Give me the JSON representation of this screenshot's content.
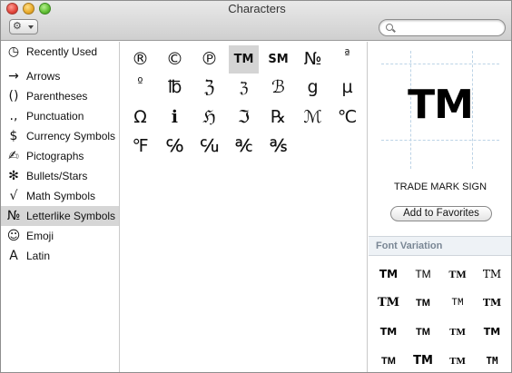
{
  "window": {
    "title": "Characters"
  },
  "toolbar": {
    "gear_icon": "gear-icon",
    "search_placeholder": "",
    "search_value": ""
  },
  "sidebar": {
    "items": [
      {
        "icon": "◷",
        "label": "Recently Used",
        "selected": false
      },
      {
        "icon": "→",
        "label": "Arrows",
        "selected": false
      },
      {
        "icon": "()",
        "label": "Parentheses",
        "selected": false
      },
      {
        "icon": ".,",
        "label": "Punctuation",
        "selected": false
      },
      {
        "icon": "$",
        "label": "Currency Symbols",
        "selected": false
      },
      {
        "icon": "✍",
        "label": "Pictographs",
        "selected": false
      },
      {
        "icon": "✻",
        "label": "Bullets/Stars",
        "selected": false
      },
      {
        "icon": "√",
        "label": "Math Symbols",
        "selected": false
      },
      {
        "icon": "№",
        "label": "Letterlike Symbols",
        "selected": true
      },
      {
        "icon": "☺",
        "label": "Emoji",
        "selected": false
      },
      {
        "icon": "A",
        "label": "Latin",
        "selected": false
      }
    ]
  },
  "grid": {
    "selected_index": 3,
    "chars": [
      "®",
      "©",
      "℗",
      "™",
      "℠",
      "№",
      "ª",
      "º",
      "℔",
      "ℨ",
      "ℨ",
      "ℬ",
      "g",
      "µ",
      "Ω",
      "ℹ",
      "ℌ",
      "ℑ",
      "℞",
      "ℳ",
      "℃",
      "℉",
      "℅",
      "℆",
      "℀",
      "℁"
    ]
  },
  "info": {
    "glyph": "TM",
    "name": "TRADE MARK SIGN",
    "add_to_favorites": "Add to Favorites"
  },
  "font_variation": {
    "header": "Font Variation",
    "samples": [
      "TM",
      "TM",
      "TM",
      "TM",
      "TM",
      "TM",
      "TM",
      "TM",
      "TM",
      "TM",
      "TM",
      "TM",
      "TM",
      "TM",
      "TM",
      "TM"
    ]
  }
}
